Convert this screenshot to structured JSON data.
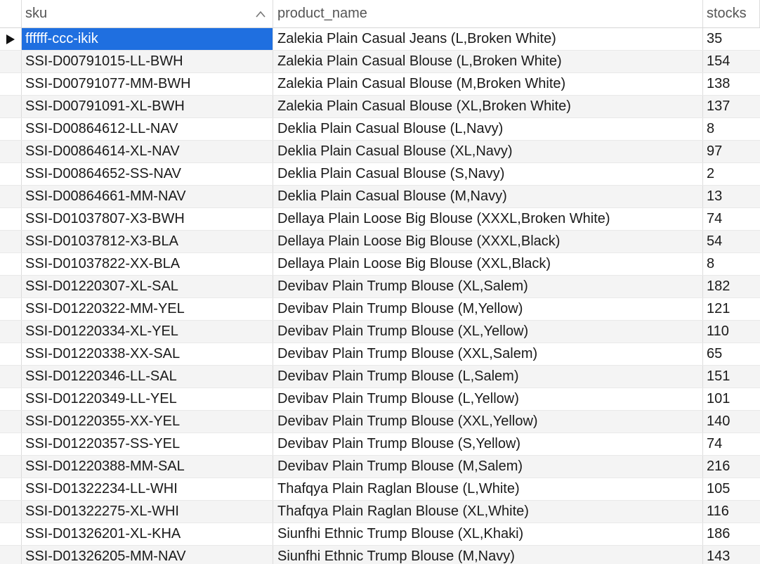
{
  "columns": {
    "sku": "sku",
    "product_name": "product_name",
    "stocks": "stocks"
  },
  "sort": {
    "column": "sku",
    "direction": "ascending",
    "icon": "chevron-up-icon"
  },
  "selected_row": 0,
  "rows": [
    {
      "sku": "ffffff-ccc-ikik",
      "product_name": "Zalekia Plain Casual Jeans (L,Broken White)",
      "stocks": "35"
    },
    {
      "sku": "SSI-D00791015-LL-BWH",
      "product_name": "Zalekia Plain Casual Blouse (L,Broken White)",
      "stocks": "154"
    },
    {
      "sku": "SSI-D00791077-MM-BWH",
      "product_name": "Zalekia Plain Casual Blouse (M,Broken White)",
      "stocks": "138"
    },
    {
      "sku": "SSI-D00791091-XL-BWH",
      "product_name": "Zalekia Plain Casual Blouse (XL,Broken White)",
      "stocks": "137"
    },
    {
      "sku": "SSI-D00864612-LL-NAV",
      "product_name": "Deklia Plain Casual Blouse (L,Navy)",
      "stocks": "8"
    },
    {
      "sku": "SSI-D00864614-XL-NAV",
      "product_name": "Deklia Plain Casual Blouse (XL,Navy)",
      "stocks": "97"
    },
    {
      "sku": "SSI-D00864652-SS-NAV",
      "product_name": "Deklia Plain Casual Blouse (S,Navy)",
      "stocks": "2"
    },
    {
      "sku": "SSI-D00864661-MM-NAV",
      "product_name": "Deklia Plain Casual Blouse (M,Navy)",
      "stocks": "13"
    },
    {
      "sku": "SSI-D01037807-X3-BWH",
      "product_name": "Dellaya Plain Loose Big Blouse (XXXL,Broken White)",
      "stocks": "74"
    },
    {
      "sku": "SSI-D01037812-X3-BLA",
      "product_name": "Dellaya Plain Loose Big Blouse (XXXL,Black)",
      "stocks": "54"
    },
    {
      "sku": "SSI-D01037822-XX-BLA",
      "product_name": "Dellaya Plain Loose Big Blouse (XXL,Black)",
      "stocks": "8"
    },
    {
      "sku": "SSI-D01220307-XL-SAL",
      "product_name": "Devibav Plain Trump Blouse (XL,Salem)",
      "stocks": "182"
    },
    {
      "sku": "SSI-D01220322-MM-YEL",
      "product_name": "Devibav Plain Trump Blouse (M,Yellow)",
      "stocks": "121"
    },
    {
      "sku": "SSI-D01220334-XL-YEL",
      "product_name": "Devibav Plain Trump Blouse (XL,Yellow)",
      "stocks": "110"
    },
    {
      "sku": "SSI-D01220338-XX-SAL",
      "product_name": "Devibav Plain Trump Blouse (XXL,Salem)",
      "stocks": "65"
    },
    {
      "sku": "SSI-D01220346-LL-SAL",
      "product_name": "Devibav Plain Trump Blouse (L,Salem)",
      "stocks": "151"
    },
    {
      "sku": "SSI-D01220349-LL-YEL",
      "product_name": "Devibav Plain Trump Blouse (L,Yellow)",
      "stocks": "101"
    },
    {
      "sku": "SSI-D01220355-XX-YEL",
      "product_name": "Devibav Plain Trump Blouse (XXL,Yellow)",
      "stocks": "140"
    },
    {
      "sku": "SSI-D01220357-SS-YEL",
      "product_name": "Devibav Plain Trump Blouse (S,Yellow)",
      "stocks": "74"
    },
    {
      "sku": "SSI-D01220388-MM-SAL",
      "product_name": "Devibav Plain Trump Blouse (M,Salem)",
      "stocks": "216"
    },
    {
      "sku": "SSI-D01322234-LL-WHI",
      "product_name": "Thafqya Plain Raglan Blouse (L,White)",
      "stocks": "105"
    },
    {
      "sku": "SSI-D01322275-XL-WHI",
      "product_name": "Thafqya Plain Raglan Blouse (XL,White)",
      "stocks": "116"
    },
    {
      "sku": "SSI-D01326201-XL-KHA",
      "product_name": "Siunfhi Ethnic Trump Blouse (XL,Khaki)",
      "stocks": "186"
    },
    {
      "sku": "SSI-D01326205-MM-NAV",
      "product_name": "Siunfhi Ethnic Trump Blouse (M,Navy)",
      "stocks": "143"
    }
  ],
  "colors": {
    "selection": "#1f6fe0",
    "alt_row": "#f4f4f4",
    "grid_line": "#dcdcdc"
  }
}
